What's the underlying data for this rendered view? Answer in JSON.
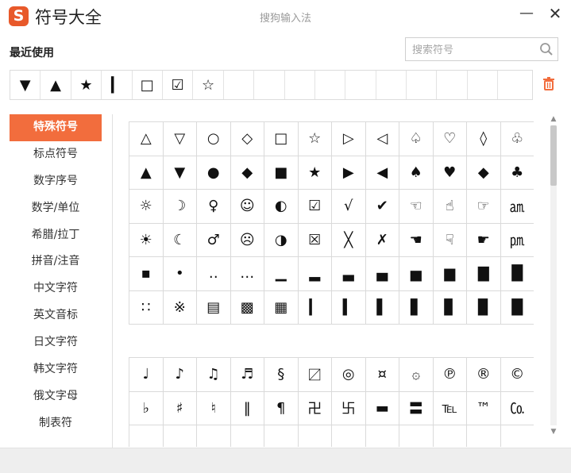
{
  "app": {
    "logo_letter": "S",
    "title": "符号大全",
    "window_title": "搜狗输入法",
    "minimize": "—",
    "close": "✕"
  },
  "recent": {
    "label": "最近使用",
    "search_placeholder": "搜索符号",
    "symbols": [
      "▼",
      "▲",
      "★",
      "▎",
      "□",
      "☑",
      "☆",
      "",
      "",
      "",
      "",
      "",
      "",
      "",
      "",
      "",
      ""
    ]
  },
  "sidebar": {
    "categories": [
      {
        "label": "特殊符号",
        "active": true
      },
      {
        "label": "标点符号",
        "active": false
      },
      {
        "label": "数字序号",
        "active": false
      },
      {
        "label": "数学/单位",
        "active": false
      },
      {
        "label": "希腊/拉丁",
        "active": false
      },
      {
        "label": "拼音/注音",
        "active": false
      },
      {
        "label": "中文字符",
        "active": false
      },
      {
        "label": "英文音标",
        "active": false
      },
      {
        "label": "日文字符",
        "active": false
      },
      {
        "label": "韩文字符",
        "active": false
      },
      {
        "label": "俄文字母",
        "active": false
      },
      {
        "label": "制表符",
        "active": false
      }
    ]
  },
  "grid1": [
    [
      "△",
      "▽",
      "○",
      "◇",
      "□",
      "☆",
      "▷",
      "◁",
      "♤",
      "♡",
      "◊",
      "♧"
    ],
    [
      "▲",
      "▼",
      "●",
      "◆",
      "■",
      "★",
      "▶",
      "◀",
      "♠",
      "♥",
      "◆",
      "♣"
    ],
    [
      "☼",
      "☽",
      "♀",
      "☺",
      "◐",
      "☑",
      "√",
      "✔",
      "☜",
      "☝",
      "☞",
      "㏂"
    ],
    [
      "☀",
      "☾",
      "♂",
      "☹",
      "◑",
      "☒",
      "╳",
      "✗",
      "☚",
      "☟",
      "☛",
      "㏘"
    ],
    [
      "▪",
      "•",
      "‥",
      "…",
      "▁",
      "▂",
      "▃",
      "▄",
      "▅",
      "▆",
      "▇",
      "█"
    ],
    [
      "∷",
      "※",
      "▤",
      "▩",
      "▦",
      "▎",
      "▍",
      "▌",
      "▋",
      "▊",
      "▉",
      "█"
    ]
  ],
  "grid2": [
    [
      "♩",
      "♪",
      "♫",
      "♬",
      "§",
      "〼",
      "◎",
      "¤",
      "۞",
      "℗",
      "®",
      "©"
    ],
    [
      "♭",
      "♯",
      "♮",
      "‖",
      "¶",
      "卍",
      "卐",
      "▬",
      "〓",
      "℡",
      "™",
      "㏇"
    ],
    [
      "",
      "",
      "",
      "",
      "",
      "",
      "",
      "",
      "",
      "",
      "",
      ""
    ]
  ],
  "colors": {
    "accent": "#f26d3d",
    "logo": "#e8592a"
  }
}
